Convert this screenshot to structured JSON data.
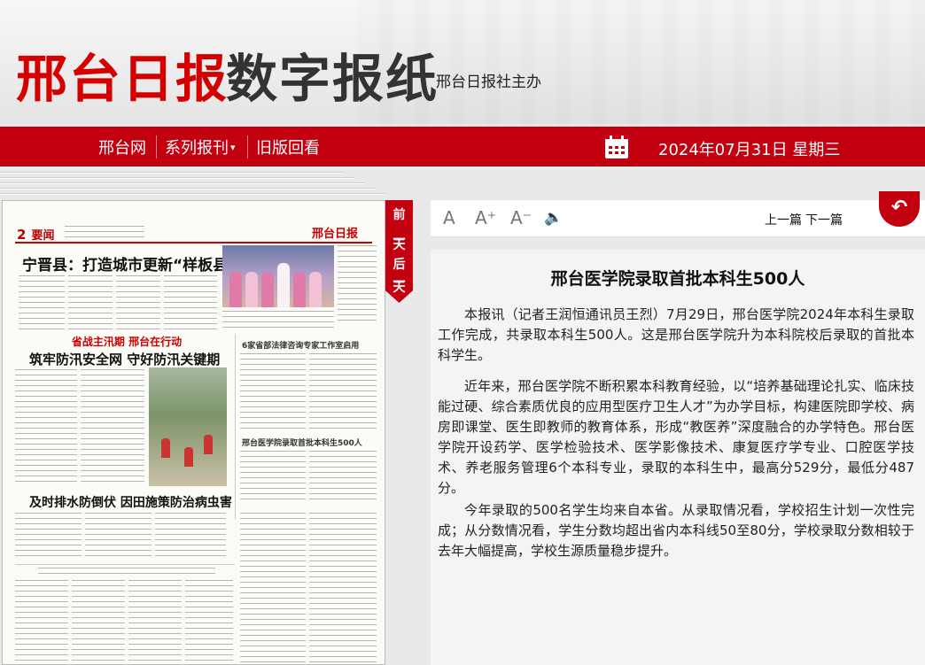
{
  "header": {
    "brand_red": "邢台日报",
    "brand_dark": "数字报纸",
    "sponsor": "邢台日报社主办"
  },
  "nav": {
    "items": [
      {
        "label": "邢台网"
      },
      {
        "label": "系列报刊"
      },
      {
        "label": "旧版回看"
      }
    ],
    "dropdown_glyph": "▾",
    "date": "2024年07月31日 星期三"
  },
  "newspaper": {
    "page_number": "2",
    "page_section": "要闻",
    "logo_text": "邢台日报",
    "headline_1": "宁晋县：打造城市更新“样板县”",
    "banner_label": "省战主汛期  邢台在行动",
    "headline_2": "筑牢防汛安全网  守好防汛关键期",
    "sub_head_1": "6家省部法律咨询专家工作室启用",
    "sub_head_2": "邢台医学院录取首批本科生500人",
    "headline_3": "及时排水防倒伏  因田施策防治病虫害"
  },
  "date_tab": {
    "prev_chars": [
      "前",
      "一",
      "天"
    ],
    "next_chars": [
      "后",
      "一",
      "天"
    ]
  },
  "toolbar": {
    "font_normal": "A",
    "font_larger": "A⁺",
    "font_smaller": "A⁻",
    "audio_glyph": "🔈",
    "prev_article": "上一篇",
    "next_article": "下一篇",
    "back_glyph": "↶"
  },
  "article": {
    "title": "邢台医学院录取首批本科生500人",
    "paragraphs": [
      "本报讯（记者王润恒通讯员王烈）7月29日，邢台医学院2024年本科生录取工作完成，共录取本科生500人。这是邢台医学院升为本科院校后录取的首批本科学生。",
      "近年来，邢台医学院不断积累本科教育经验，以“培养基础理论扎实、临床技能过硬、综合素质优良的应用型医疗卫生人才”为办学目标，构建医院即学校、病房即课堂、医生即教师的教育体系，形成“教医养”深度融合的办学特色。邢台医学院开设药学、医学检验技术、医学影像技术、康复医疗学专业、口腔医学技术、养老服务管理6个本科专业，录取的本科生中，最高分529分，最低分487分。",
      "今年录取的500名学生均来自本省。从录取情况看，学校招生计划一次性完成；从分数情况看，学生分数均超出省内本科线50至80分，学校录取分数相较于去年大幅提高，学校生源质量稳步提升。"
    ]
  },
  "colors": {
    "brand_red": "#c20010",
    "title_red": "#d40000"
  }
}
